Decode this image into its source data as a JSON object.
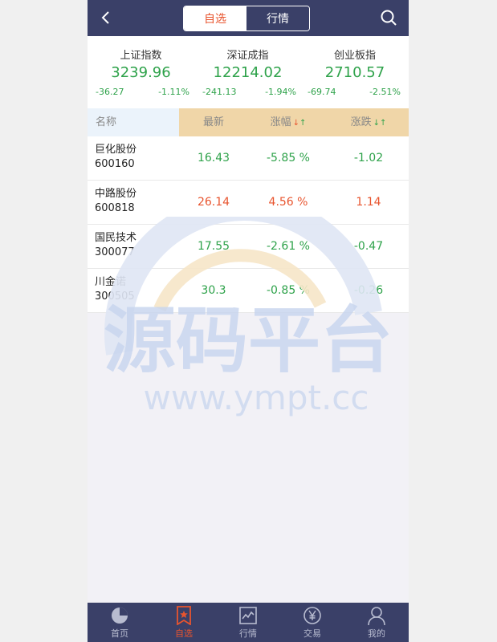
{
  "header": {
    "tabs": [
      {
        "label": "自选",
        "active": true
      },
      {
        "label": "行情",
        "active": false
      }
    ]
  },
  "indices": [
    {
      "name": "上证指数",
      "value": "3239.96",
      "change": "-36.27",
      "pct": "-1.11%"
    },
    {
      "name": "深证成指",
      "value": "12214.02",
      "change": "-241.13",
      "pct": "-1.94%"
    },
    {
      "name": "创业板指",
      "value": "2710.57",
      "change": "-69.74",
      "pct": "-2.51%"
    }
  ],
  "table": {
    "headers": {
      "name": "名称",
      "last": "最新",
      "pct": "涨幅",
      "chg": "涨跌"
    },
    "rows": [
      {
        "name": "巨化股份",
        "code": "600160",
        "last": "16.43",
        "pct": "-5.85 %",
        "chg": "-1.02",
        "trend": "down"
      },
      {
        "name": "中路股份",
        "code": "600818",
        "last": "26.14",
        "pct": "4.56 %",
        "chg": "1.14",
        "trend": "up"
      },
      {
        "name": "国民技术",
        "code": "300077",
        "last": "17.55",
        "pct": "-2.61 %",
        "chg": "-0.47",
        "trend": "down"
      },
      {
        "name": "川金诺",
        "code": "300505",
        "last": "30.3",
        "pct": "-0.85 %",
        "chg": "-0.26",
        "trend": "down"
      }
    ]
  },
  "watermark": {
    "title": "源码平台",
    "url": "www.ympt.cc"
  },
  "bottom_nav": [
    {
      "label": "首页",
      "icon": "pie-chart-icon",
      "active": false
    },
    {
      "label": "自选",
      "icon": "bookmark-star-icon",
      "active": true
    },
    {
      "label": "行情",
      "icon": "line-chart-icon",
      "active": false
    },
    {
      "label": "交易",
      "icon": "yen-coin-icon",
      "active": false
    },
    {
      "label": "我的",
      "icon": "user-icon",
      "active": false
    }
  ],
  "colors": {
    "header_bg": "#3a4068",
    "accent": "#e8542e",
    "down": "#2ea24a",
    "table_header_bg": "#f0d6a8"
  }
}
